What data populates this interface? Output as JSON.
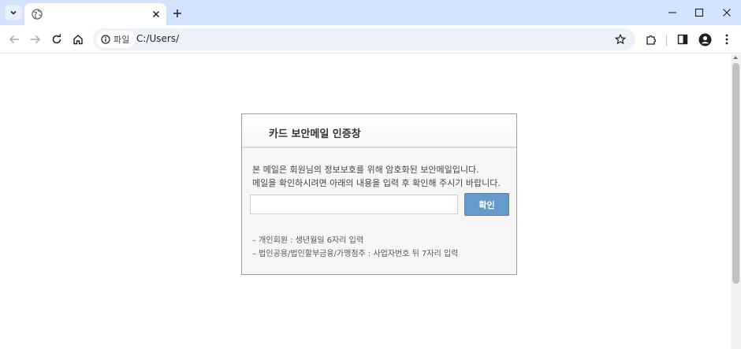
{
  "browser": {
    "site_info_label": "파일",
    "url": "C:/Users/"
  },
  "dialog": {
    "title": "카드 보안메일 인증창",
    "message_line1": "본 메일은 회원님의 정보보호를 위해 암호화된 보안메일입니다.",
    "message_line2": "메일을 확인하시려면 아래의 내용을 입력 후 확인해 주시기 바랍니다.",
    "input_value": "",
    "confirm_label": "확인",
    "note1": "– 개인회원 : 생년월일 6자리 입력",
    "note2": "– 법인공용/법인할부금융/가맹점주 : 사업자번호 뒤 7자리 입력"
  },
  "colors": {
    "tabstrip": "#d3e3fd",
    "omnibox": "#edf2fa",
    "confirm_button": "#659bcb"
  }
}
